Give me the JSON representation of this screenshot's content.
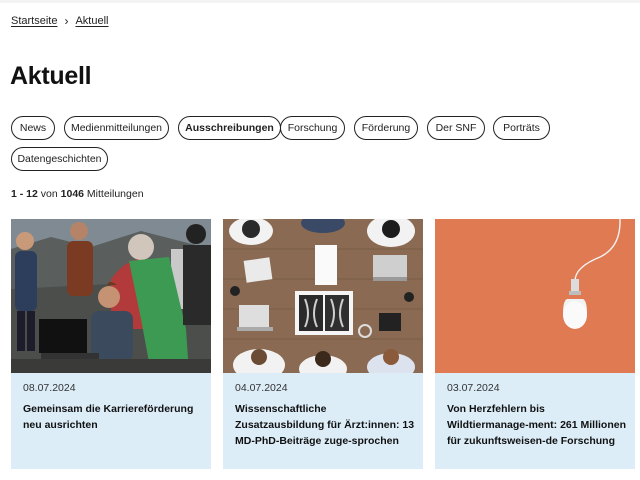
{
  "breadcrumb": {
    "home": "Startseite",
    "separator": "›",
    "current": "Aktuell"
  },
  "page_title": "Aktuell",
  "filters": [
    {
      "label": "News",
      "active": false
    },
    {
      "label": "Medienmitteilungen",
      "active": false
    },
    {
      "label": "Ausschreibungen",
      "active": true
    },
    {
      "label": "Forschung",
      "active": false
    },
    {
      "label": "Förderung",
      "active": false
    },
    {
      "label": "Der SNF",
      "active": false
    },
    {
      "label": "Porträts",
      "active": false
    },
    {
      "label": "Datengeschichten",
      "active": false
    }
  ],
  "result_count": {
    "range": "1 - 12",
    "von": "von",
    "total": "1046",
    "unit": "Mitteilungen"
  },
  "cards": [
    {
      "date": "08.07.2024",
      "title": "Gemeinsam die Karriereförderung neu ausrichten",
      "image": "group-outdoor-laptop-photo"
    },
    {
      "date": "04.07.2024",
      "title": "Wissenschaftliche Zusatzausbildung für Ärzt:innen: 13 MD-PhD-Beiträge zuge-sprochen",
      "image": "doctors-xray-table-photo"
    },
    {
      "date": "03.07.2024",
      "title": "Von Herzfehlern bis Wildtiermanage-ment: 261 Millionen für zukunftsweisen-de Forschung",
      "image": "lightbulb-orange-photo"
    }
  ],
  "colors": {
    "card_background": "#dcedf8",
    "orange_backdrop": "#e07a52",
    "text": "#111111"
  }
}
